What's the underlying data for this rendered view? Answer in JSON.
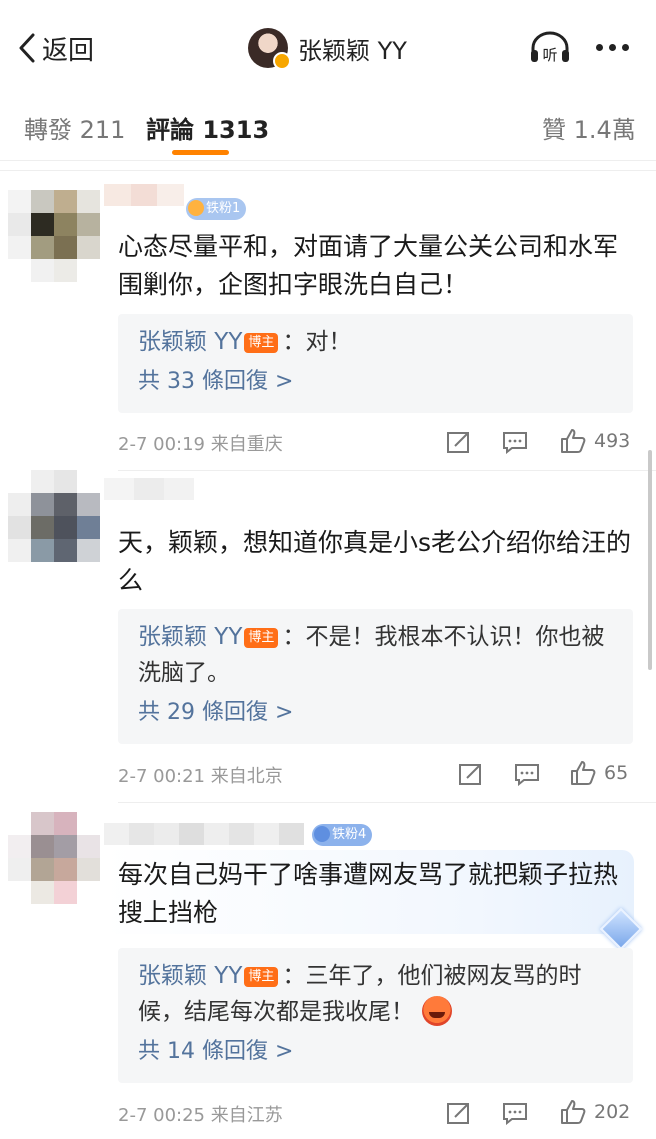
{
  "nav": {
    "back_label": "返回",
    "title": "张颖颖 YY",
    "listen_label": "听"
  },
  "tabs": {
    "repost": "轉發 211",
    "comments": "評論 1313",
    "likes": "贊 1.4萬"
  },
  "comments": [
    {
      "badge": "铁粉1",
      "text": "心态尽量平和，对面请了大量公关公司和水军围剿你，企图扣字眼洗白自己！",
      "reply": {
        "author": "张颖颖 YY",
        "tag": "博主",
        "text": "：对！",
        "more": "共 33 條回復 >"
      },
      "time": "2-7 00:19 来自重庆",
      "likes": "493"
    },
    {
      "badge": "",
      "text": "天，颖颖，想知道你真是小s老公介绍你给汪的么",
      "reply": {
        "author": "张颖颖 YY",
        "tag": "博主",
        "text": "：不是！我根本不认识！你也被洗脑了。",
        "more": "共 29 條回復 >"
      },
      "time": "2-7 00:21 来自北京",
      "likes": "65"
    },
    {
      "badge": "铁粉4",
      "text": "每次自己妈干了啥事遭网友骂了就把颖子拉热搜上挡枪",
      "reply": {
        "author": "张颖颖 YY",
        "tag": "博主",
        "text": "：三年了，他们被网友骂的时候，结尾每次都是我收尾！",
        "more": "共 14 條回復 >"
      },
      "time": "2-7 00:25 来自江苏",
      "likes": "202"
    }
  ],
  "colors": {
    "accent": "#ff8200",
    "link": "#53739c",
    "blogger_tag": "#ff6e17"
  }
}
